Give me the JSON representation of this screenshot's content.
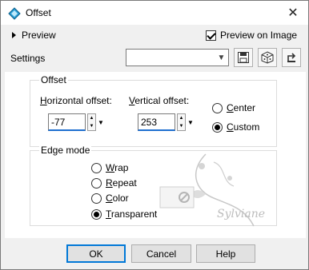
{
  "window": {
    "title": "Offset",
    "icon": "app-icon",
    "close": "✕"
  },
  "preview_toggle": {
    "label": "Preview"
  },
  "preview_on_image": {
    "label": "Preview on Image",
    "checked": true
  },
  "settings": {
    "label": "Settings",
    "value": "",
    "buttons": [
      "save-preset-icon",
      "randomize-icon",
      "reset-icon"
    ]
  },
  "offset": {
    "title": "Offset",
    "horizontal_label": "Horizontal offset:",
    "horizontal_key": "H",
    "horizontal_rest": "orizontal offset:",
    "horizontal_value": "-77",
    "vertical_key": "V",
    "vertical_rest": "ertical offset:",
    "vertical_value": "253",
    "center_key": "C",
    "center_rest": "enter",
    "custom_key": "C",
    "custom_rest": "ustom",
    "selected": "Custom"
  },
  "edge_mode": {
    "title": "Edge mode",
    "options": [
      {
        "key": "W",
        "rest": "rap"
      },
      {
        "key": "R",
        "rest": "epeat"
      },
      {
        "key": "C",
        "rest": "olor"
      },
      {
        "key": "T",
        "rest": "ransparent"
      }
    ],
    "selected": "Transparent"
  },
  "watermark_text": "Sylviane",
  "buttons": {
    "ok": "OK",
    "cancel": "Cancel",
    "help": "Help"
  }
}
